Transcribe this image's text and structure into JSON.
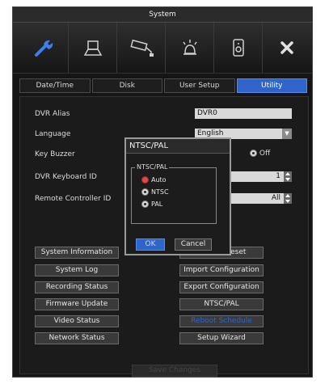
{
  "window": {
    "title": "System"
  },
  "iconbar": [
    "wrench-icon",
    "disk-icon",
    "camera-icon",
    "alarm-icon",
    "speaker-icon",
    "close-icon"
  ],
  "tabs": [
    "Date/Time",
    "Disk",
    "User Setup",
    "Utility"
  ],
  "fields": {
    "dvr_alias_label": "DVR Alias",
    "dvr_alias_value": "DVR0",
    "language_label": "Language",
    "language_value": "English",
    "key_buzzer_label": "Key Buzzer",
    "key_buzzer_off": "Off",
    "keyboard_id_label": "DVR Keyboard ID",
    "keyboard_id_value": "1",
    "remote_id_label": "Remote Controller ID",
    "remote_id_value": "All"
  },
  "buttons_left": [
    "System Information",
    "System Log",
    "Recording Status",
    "Firmware Update",
    "Video Status",
    "Network Status"
  ],
  "buttons_right": [
    "Factory Reset",
    "Import Configuration",
    "Export Configuration",
    "NTSC/PAL",
    "Reboot Schedule",
    "Setup Wizard"
  ],
  "save_changes": "Save Changes",
  "dialog": {
    "title": "NTSC/PAL",
    "group_title": "NTSC/PAL",
    "options": [
      "Auto",
      "NTSC",
      "PAL"
    ],
    "ok": "OK",
    "cancel": "Cancel"
  }
}
